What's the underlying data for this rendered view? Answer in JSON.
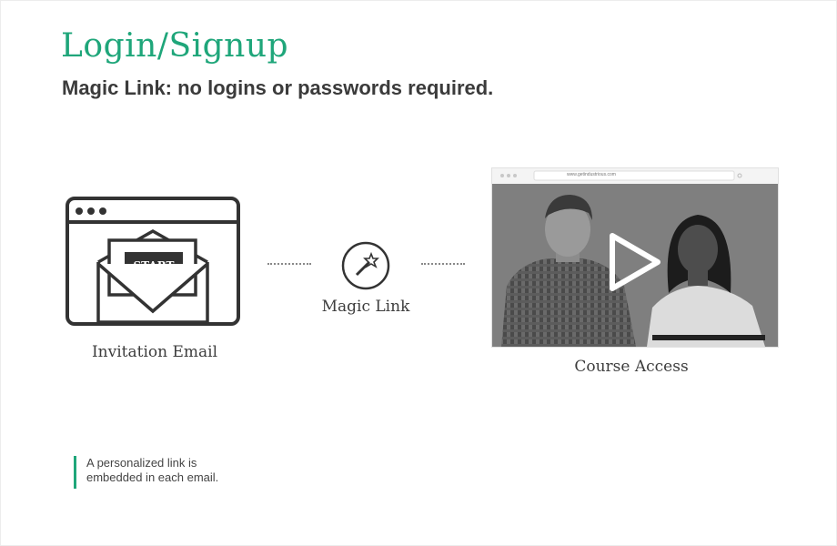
{
  "header": {
    "title": "Login/Signup",
    "subtitle": "Magic Link: no logins or passwords required."
  },
  "steps": {
    "email": {
      "label": "Invitation Email",
      "button_text": "START"
    },
    "magic": {
      "label": "Magic Link"
    },
    "course": {
      "label": "Course Access",
      "url": "www.getindustrious.com"
    }
  },
  "note": {
    "line1": "A personalized link is",
    "line2": "embedded in each email."
  },
  "colors": {
    "accent": "#1fa67a",
    "icon_stroke": "#333333"
  },
  "icons": [
    "browser-window-icon",
    "envelope-icon",
    "magic-wand-icon",
    "play-icon"
  ]
}
